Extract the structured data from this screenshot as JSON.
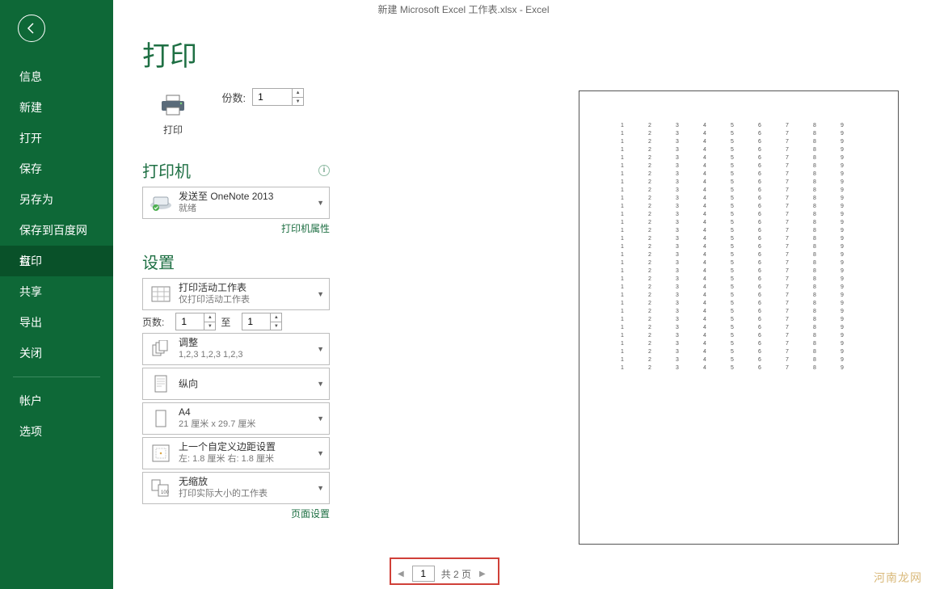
{
  "title": "新建 Microsoft Excel 工作表.xlsx - Excel",
  "sidebar": {
    "items": [
      "信息",
      "新建",
      "打开",
      "保存",
      "另存为",
      "保存到百度网盘",
      "打印",
      "共享",
      "导出",
      "关闭"
    ],
    "account": "帐户",
    "options": "选项",
    "activeIndex": 6
  },
  "main": {
    "heading": "打印",
    "printBtn": "打印",
    "copiesLabel": "份数:",
    "copiesValue": "1"
  },
  "printer": {
    "heading": "打印机",
    "name": "发送至 OneNote 2013",
    "status": "就绪",
    "propsLink": "打印机属性"
  },
  "settings": {
    "heading": "设置",
    "activeSheets": {
      "title": "打印活动工作表",
      "sub": "仅打印活动工作表"
    },
    "pagesLabel": "页数:",
    "pagesFrom": "1",
    "pagesToLabel": "至",
    "pagesTo": "1",
    "collate": {
      "title": "调整",
      "sub": "1,2,3    1,2,3    1,2,3"
    },
    "orient": {
      "title": "纵向"
    },
    "paper": {
      "title": "A4",
      "sub": "21 厘米 x 29.7 厘米"
    },
    "margins": {
      "title": "上一个自定义边距设置",
      "sub": "左:  1.8 厘米    右:  1.8 厘米"
    },
    "scale": {
      "title": "无缩放",
      "sub": "打印实际大小的工作表"
    },
    "pageSetupLink": "页面设置"
  },
  "preview": {
    "cols": [
      1,
      2,
      3,
      4,
      5,
      6,
      7,
      8,
      9
    ],
    "rows": 31
  },
  "pager": {
    "current": "1",
    "total": "共 2 页"
  },
  "watermark": "河南龙网"
}
